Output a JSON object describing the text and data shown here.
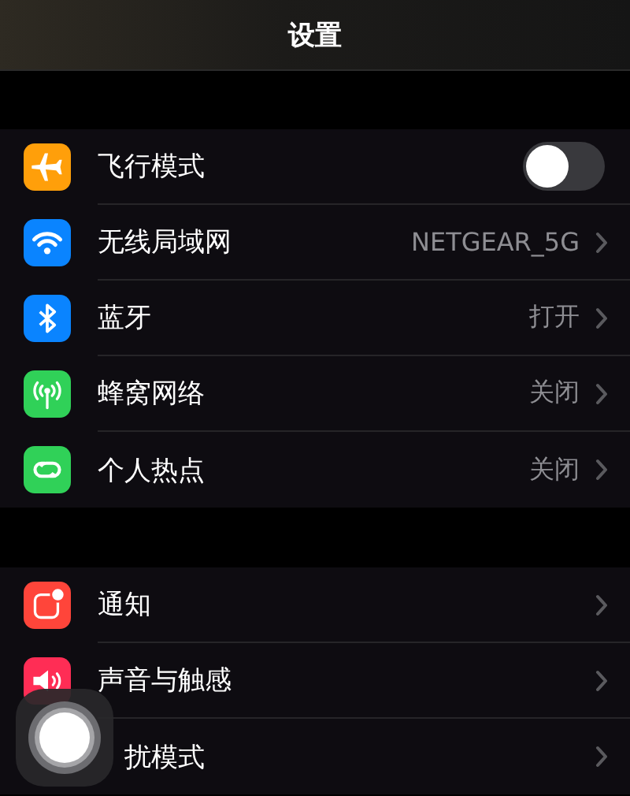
{
  "header": {
    "title": "设置"
  },
  "groups": [
    {
      "rows": [
        {
          "color": "#ff9f0a",
          "label": "飞行模式",
          "kind": "toggle",
          "on": false
        },
        {
          "color": "#0a84ff",
          "label": "无线局域网",
          "kind": "link",
          "value": "NETGEAR_5G"
        },
        {
          "color": "#0a84ff",
          "label": "蓝牙",
          "kind": "link",
          "value": "打开"
        },
        {
          "color": "#30d158",
          "label": "蜂窝网络",
          "kind": "link",
          "value": "关闭"
        },
        {
          "color": "#30d158",
          "label": "个人热点",
          "kind": "link",
          "value": "关闭"
        }
      ]
    },
    {
      "rows": [
        {
          "color": "#ff453a",
          "label": "通知",
          "kind": "link"
        },
        {
          "color": "#ff2d55",
          "label": "声音与触感",
          "kind": "link"
        },
        {
          "label": "扰模式",
          "kind": "link",
          "covered": true
        }
      ]
    }
  ],
  "floating_button": {
    "kind": "assistive-touch"
  }
}
